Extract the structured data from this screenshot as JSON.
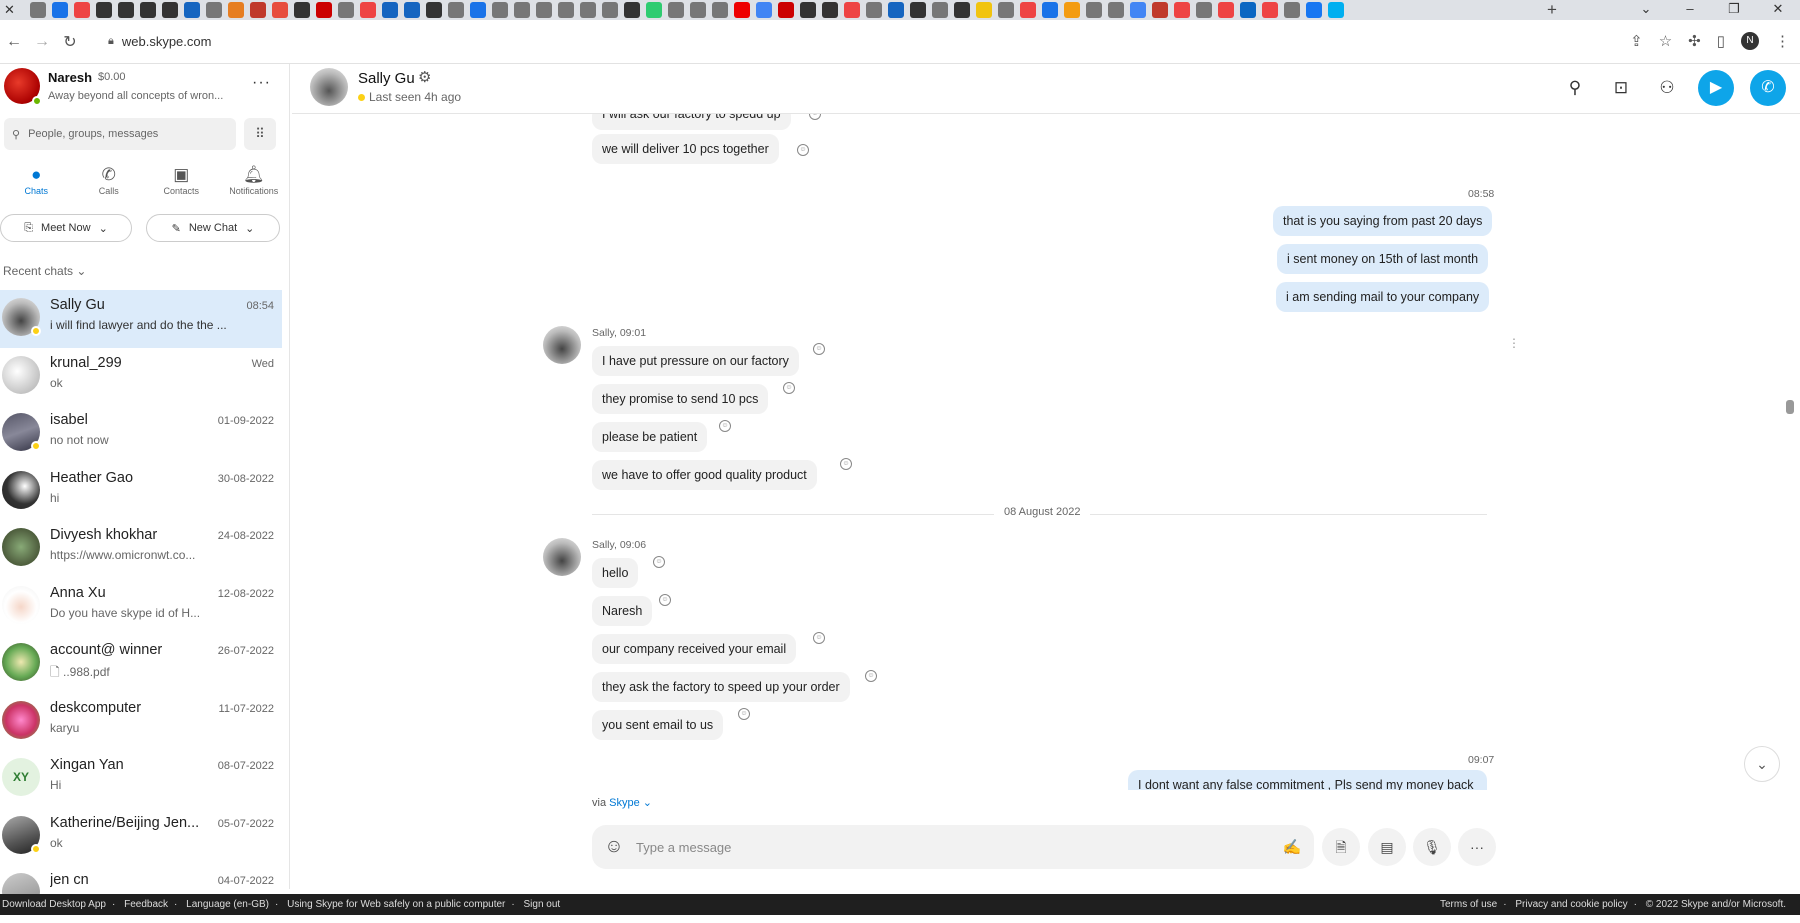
{
  "browser": {
    "url": "web.skype.com",
    "favicon_colors": [
      "#777",
      "#1a73e8",
      "#e44",
      "#333",
      "#333",
      "#333",
      "#333",
      "#1565c0",
      "#777",
      "#e67e22",
      "#c0392b",
      "#e74c3c",
      "#333",
      "#c00",
      "#777",
      "#e44",
      "#1565c0",
      "#1565c0",
      "#333",
      "#777",
      "#1a73e8",
      "#777",
      "#777",
      "#777",
      "#777",
      "#777",
      "#777",
      "#333",
      "#2ecc71",
      "#777",
      "#777",
      "#777",
      "#e00",
      "#4285f4",
      "#c00",
      "#333",
      "#333",
      "#e44",
      "#777",
      "#1565c0",
      "#333",
      "#777",
      "#333",
      "#f1c40f",
      "#777",
      "#e44",
      "#1a73e8",
      "#f39c12",
      "#777",
      "#777",
      "#4285f4",
      "#c0392b",
      "#e44",
      "#777",
      "#e44",
      "#0a66c2",
      "#e44",
      "#777",
      "#1877f2",
      "#00aff0"
    ]
  },
  "profile": {
    "name": "Naresh",
    "balance": "$0.00",
    "status": "Away beyond all concepts of wron...",
    "browser_initial": "N"
  },
  "search": {
    "placeholder": "People, groups, messages"
  },
  "nav_tabs": [
    {
      "label": "Chats"
    },
    {
      "label": "Calls"
    },
    {
      "label": "Contacts"
    },
    {
      "label": "Notifications"
    }
  ],
  "buttons": {
    "meet_now": "Meet Now",
    "new_chat": "New Chat"
  },
  "recent_label": "Recent chats",
  "chats": [
    {
      "name": "Sally Gu",
      "preview": "i will find lawyer and do the the ...",
      "time": "08:54"
    },
    {
      "name": "krunal_299",
      "preview": "ok",
      "time": "Wed"
    },
    {
      "name": "isabel",
      "preview": "no not now",
      "time": "01-09-2022"
    },
    {
      "name": "Heather Gao",
      "preview": "hi",
      "time": "30-08-2022"
    },
    {
      "name": "Divyesh khokhar",
      "preview": "https://www.omicronwt.co...",
      "time": "24-08-2022"
    },
    {
      "name": "Anna Xu",
      "preview": "Do you have skype id of H...",
      "time": "12-08-2022"
    },
    {
      "name": "account@ winner",
      "preview": "..988.pdf",
      "time": "26-07-2022"
    },
    {
      "name": "deskcomputer",
      "preview": "karyu",
      "time": "11-07-2022"
    },
    {
      "name": "Xingan  Yan",
      "preview": "Hi",
      "time": "08-07-2022",
      "initials": "XY"
    },
    {
      "name": "Katherine/Beijing Jen...",
      "preview": "ok",
      "time": "05-07-2022"
    },
    {
      "name": "jen cn",
      "preview": "",
      "time": "04-07-2022"
    }
  ],
  "conversation": {
    "name": "Sally Gu",
    "last_seen": "Last seen 4h ago",
    "messages": {
      "m1": "I will ask our factory to spedd up",
      "m2": "we will deliver 10 pcs together",
      "t1": "08:58",
      "o1": "that is you saying from past 20 days",
      "o2": "i sent money on 15th of last month",
      "o3": "i am sending mail to your company",
      "s1": "Sally, 09:01",
      "m3": "I have put pressure on our factory",
      "m4": "they promise to send 10 pcs",
      "m5": "please be patient",
      "m6": "we have to offer good quality product",
      "date": "08 August 2022",
      "s2": "Sally, 09:06",
      "m7": "hello",
      "m8": "Naresh",
      "m9": "our company received your email",
      "m10": "they ask the factory to speed up your order",
      "m11": "you sent email to us",
      "t2": "09:07",
      "o4": "I dont want any false commitment , Pls send my money back"
    }
  },
  "via": {
    "prefix": "via",
    "link": "Skype"
  },
  "composer": {
    "placeholder": "Type a message"
  },
  "footer": {
    "left": [
      "Download Desktop App",
      "Feedback",
      "Language (en-GB)",
      "Using Skype for Web safely on a public computer",
      "Sign out"
    ],
    "right": [
      "Terms of use",
      "Privacy and cookie policy",
      "© 2022 Skype and/or Microsoft."
    ]
  }
}
